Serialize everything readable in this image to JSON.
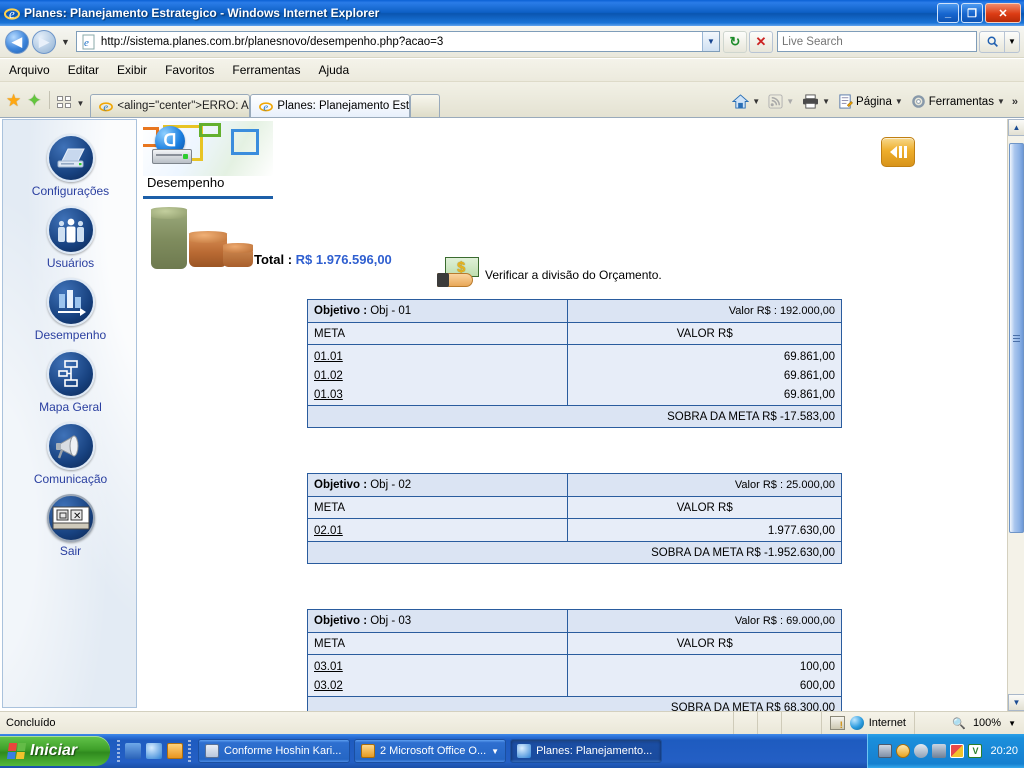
{
  "window": {
    "title": "Planes: Planejamento Estrategico - Windows Internet Explorer",
    "minimize_label": "_",
    "maximize_label": "❐",
    "close_label": "✕"
  },
  "nav": {
    "back_label": "◀",
    "forward_label": "▶",
    "history_dropdown_label": "▼",
    "url": "http://sistema.planes.com.br/planesnovo/desempenho.php?acao=3",
    "url_dropdown_label": "▼",
    "refresh_label": "↻",
    "stop_label": "✕",
    "search_placeholder": "Live Search",
    "search_value": "",
    "search_button_label": "🔍",
    "search_dropdown_label": "▼"
  },
  "menubar": {
    "items": [
      {
        "label": "Arquivo"
      },
      {
        "label": "Editar"
      },
      {
        "label": "Exibir"
      },
      {
        "label": "Favoritos"
      },
      {
        "label": "Ferramentas"
      },
      {
        "label": "Ajuda"
      }
    ]
  },
  "favbar": {
    "favorites_center_icon": "star-icon",
    "add_favorite_icon": "add-star-icon",
    "quick_tabs_icon": "quick-tabs-icon",
    "tab_list_dropdown": "▼"
  },
  "tabs": [
    {
      "label": "<aling=\"center\">ERRO: A U...",
      "active": false,
      "close_label": ""
    },
    {
      "label": "Planes: Planejamento Est...",
      "active": true,
      "close_label": "✕"
    }
  ],
  "commandbar": {
    "home_label": "",
    "home_dropdown": "▼",
    "feeds_label": "",
    "feeds_dropdown": "▼",
    "print_label": "",
    "print_dropdown": "▼",
    "page_label": "Página",
    "page_dropdown": "▼",
    "tools_label": "Ferramentas",
    "tools_dropdown": "▼",
    "overflow_label": "»"
  },
  "sidebar": {
    "items": [
      {
        "label": "Configurações",
        "icon": "laptop-icon"
      },
      {
        "label": "Usuários",
        "icon": "users-icon"
      },
      {
        "label": "Desempenho",
        "icon": "bar-chart-icon"
      },
      {
        "label": "Mapa Geral",
        "icon": "org-chart-icon"
      },
      {
        "label": "Comunicação",
        "icon": "megaphone-icon"
      },
      {
        "label": "Sair",
        "icon": "exit-window-icon"
      }
    ]
  },
  "page": {
    "section_tab_label": "Desempenho",
    "budget_link_label": "Verificar a divisão do Orçamento.",
    "budget_link_icon": "money-hand-icon",
    "collapse_button_label": "◀❙❙",
    "total_label": "Total :",
    "total_value": "R$ 1.976.596,00",
    "coins_icon": "coin-stacks-icon",
    "column_headers": {
      "meta": "META",
      "valor": "VALOR R$"
    },
    "objective_prefix": "Objetivo :",
    "value_prefix": "Valor R$ :",
    "remainder_prefix": "SOBRA DA META R$",
    "objectives": [
      {
        "name": "Obj - 01",
        "value": "192.000,00",
        "metas": [
          {
            "code": "01.01",
            "value": "69.861,00"
          },
          {
            "code": "01.02",
            "value": "69.861,00"
          },
          {
            "code": "01.03",
            "value": "69.861,00"
          }
        ],
        "remainder": "-17.583,00"
      },
      {
        "name": "Obj - 02",
        "value": "25.000,00",
        "metas": [
          {
            "code": "02.01",
            "value": "1.977.630,00"
          }
        ],
        "remainder": "-1.952.630,00"
      },
      {
        "name": "Obj - 03",
        "value": "69.000,00",
        "metas": [
          {
            "code": "03.01",
            "value": "100,00"
          },
          {
            "code": "03.02",
            "value": "600,00"
          }
        ],
        "remainder": "68.300,00"
      }
    ]
  },
  "scrollbar": {
    "up_label": "▲",
    "down_label": "▼"
  },
  "statusbar": {
    "status_text": "Concluído",
    "zone_label": "Internet",
    "zoom_label": "100%",
    "zoom_dropdown": "▼"
  },
  "taskbar": {
    "start_label": "Iniciar",
    "buttons": [
      {
        "label": "Conforme Hoshin Kari...",
        "icon": "word-doc-icon",
        "active": false,
        "dropdown": ""
      },
      {
        "label": "2 Microsoft Office O...",
        "icon": "outlook-icon",
        "active": false,
        "dropdown": "▼"
      },
      {
        "label": "Planes: Planejamento...",
        "icon": "ie-icon",
        "active": true,
        "dropdown": ""
      }
    ],
    "clock": "20:20"
  },
  "colors": {
    "title_blue": "#0d5fc4",
    "table_border": "#2a5c9e",
    "table_bg": "#e7edf8",
    "table_header_bg": "#dbe4f3",
    "sidebar_bg": "#e3ebf4",
    "link_blue": "#2a3fa0",
    "total_value_blue": "#2f5fd0",
    "accent_orange": "#eeae2c"
  }
}
